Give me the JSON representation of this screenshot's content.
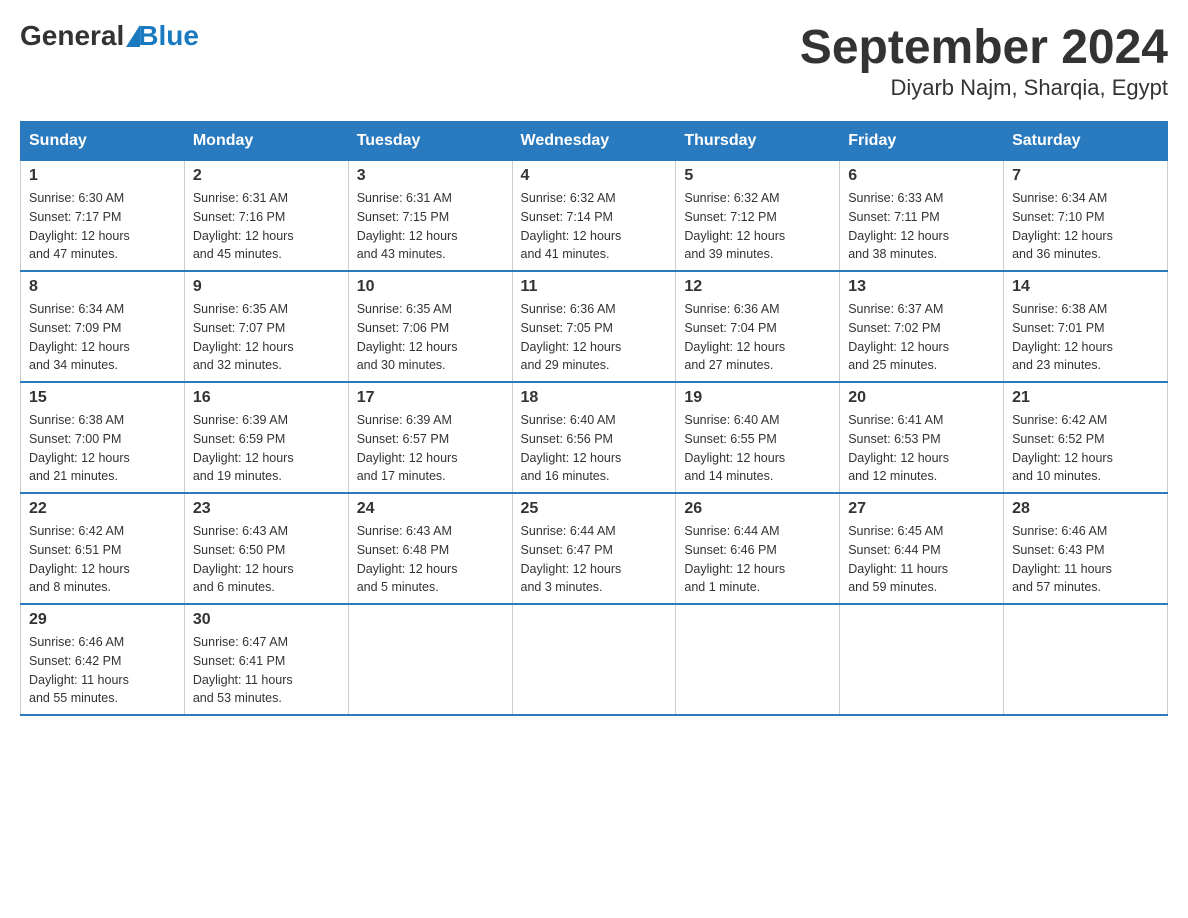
{
  "header": {
    "logo_general": "General",
    "logo_blue": "Blue",
    "title": "September 2024",
    "location": "Diyarb Najm, Sharqia, Egypt"
  },
  "weekdays": [
    "Sunday",
    "Monday",
    "Tuesday",
    "Wednesday",
    "Thursday",
    "Friday",
    "Saturday"
  ],
  "weeks": [
    [
      {
        "day": "1",
        "sunrise": "6:30 AM",
        "sunset": "7:17 PM",
        "daylight": "12 hours and 47 minutes."
      },
      {
        "day": "2",
        "sunrise": "6:31 AM",
        "sunset": "7:16 PM",
        "daylight": "12 hours and 45 minutes."
      },
      {
        "day": "3",
        "sunrise": "6:31 AM",
        "sunset": "7:15 PM",
        "daylight": "12 hours and 43 minutes."
      },
      {
        "day": "4",
        "sunrise": "6:32 AM",
        "sunset": "7:14 PM",
        "daylight": "12 hours and 41 minutes."
      },
      {
        "day": "5",
        "sunrise": "6:32 AM",
        "sunset": "7:12 PM",
        "daylight": "12 hours and 39 minutes."
      },
      {
        "day": "6",
        "sunrise": "6:33 AM",
        "sunset": "7:11 PM",
        "daylight": "12 hours and 38 minutes."
      },
      {
        "day": "7",
        "sunrise": "6:34 AM",
        "sunset": "7:10 PM",
        "daylight": "12 hours and 36 minutes."
      }
    ],
    [
      {
        "day": "8",
        "sunrise": "6:34 AM",
        "sunset": "7:09 PM",
        "daylight": "12 hours and 34 minutes."
      },
      {
        "day": "9",
        "sunrise": "6:35 AM",
        "sunset": "7:07 PM",
        "daylight": "12 hours and 32 minutes."
      },
      {
        "day": "10",
        "sunrise": "6:35 AM",
        "sunset": "7:06 PM",
        "daylight": "12 hours and 30 minutes."
      },
      {
        "day": "11",
        "sunrise": "6:36 AM",
        "sunset": "7:05 PM",
        "daylight": "12 hours and 29 minutes."
      },
      {
        "day": "12",
        "sunrise": "6:36 AM",
        "sunset": "7:04 PM",
        "daylight": "12 hours and 27 minutes."
      },
      {
        "day": "13",
        "sunrise": "6:37 AM",
        "sunset": "7:02 PM",
        "daylight": "12 hours and 25 minutes."
      },
      {
        "day": "14",
        "sunrise": "6:38 AM",
        "sunset": "7:01 PM",
        "daylight": "12 hours and 23 minutes."
      }
    ],
    [
      {
        "day": "15",
        "sunrise": "6:38 AM",
        "sunset": "7:00 PM",
        "daylight": "12 hours and 21 minutes."
      },
      {
        "day": "16",
        "sunrise": "6:39 AM",
        "sunset": "6:59 PM",
        "daylight": "12 hours and 19 minutes."
      },
      {
        "day": "17",
        "sunrise": "6:39 AM",
        "sunset": "6:57 PM",
        "daylight": "12 hours and 17 minutes."
      },
      {
        "day": "18",
        "sunrise": "6:40 AM",
        "sunset": "6:56 PM",
        "daylight": "12 hours and 16 minutes."
      },
      {
        "day": "19",
        "sunrise": "6:40 AM",
        "sunset": "6:55 PM",
        "daylight": "12 hours and 14 minutes."
      },
      {
        "day": "20",
        "sunrise": "6:41 AM",
        "sunset": "6:53 PM",
        "daylight": "12 hours and 12 minutes."
      },
      {
        "day": "21",
        "sunrise": "6:42 AM",
        "sunset": "6:52 PM",
        "daylight": "12 hours and 10 minutes."
      }
    ],
    [
      {
        "day": "22",
        "sunrise": "6:42 AM",
        "sunset": "6:51 PM",
        "daylight": "12 hours and 8 minutes."
      },
      {
        "day": "23",
        "sunrise": "6:43 AM",
        "sunset": "6:50 PM",
        "daylight": "12 hours and 6 minutes."
      },
      {
        "day": "24",
        "sunrise": "6:43 AM",
        "sunset": "6:48 PM",
        "daylight": "12 hours and 5 minutes."
      },
      {
        "day": "25",
        "sunrise": "6:44 AM",
        "sunset": "6:47 PM",
        "daylight": "12 hours and 3 minutes."
      },
      {
        "day": "26",
        "sunrise": "6:44 AM",
        "sunset": "6:46 PM",
        "daylight": "12 hours and 1 minute."
      },
      {
        "day": "27",
        "sunrise": "6:45 AM",
        "sunset": "6:44 PM",
        "daylight": "11 hours and 59 minutes."
      },
      {
        "day": "28",
        "sunrise": "6:46 AM",
        "sunset": "6:43 PM",
        "daylight": "11 hours and 57 minutes."
      }
    ],
    [
      {
        "day": "29",
        "sunrise": "6:46 AM",
        "sunset": "6:42 PM",
        "daylight": "11 hours and 55 minutes."
      },
      {
        "day": "30",
        "sunrise": "6:47 AM",
        "sunset": "6:41 PM",
        "daylight": "11 hours and 53 minutes."
      },
      null,
      null,
      null,
      null,
      null
    ]
  ],
  "labels": {
    "sunrise": "Sunrise:",
    "sunset": "Sunset:",
    "daylight": "Daylight:"
  }
}
